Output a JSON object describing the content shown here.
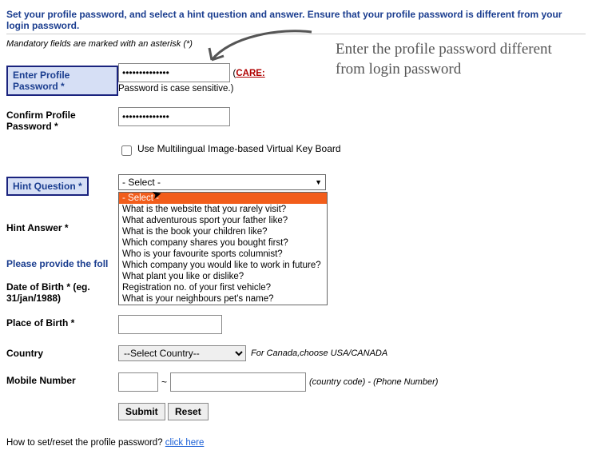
{
  "instruction": "Set your profile password, and select a hint question and answer. Ensure that your profile password is different from your login password.",
  "mandatory_note": "Mandatory fields are marked with an asterisk (*)",
  "labels": {
    "enter_profile_password": "Enter Profile Password *",
    "confirm_profile_password": "Confirm Profile Password *",
    "hint_question": "Hint Question *",
    "hint_answer": "Hint Answer *",
    "date_of_birth": "Date of Birth * (eg. 31/jan/1988)",
    "place_of_birth": "Place of Birth *",
    "country": "Country",
    "mobile_number": "Mobile Number"
  },
  "values": {
    "profile_password": "••••••••••••••",
    "confirm_password": "••••••••••••••",
    "hint_select_display": "- Select -",
    "hint_answer": "",
    "dob": "",
    "pob": "",
    "country": "--Select Country--",
    "country_code": "",
    "phone": ""
  },
  "notes": {
    "password_case": "Password is case sensitive.)",
    "care": "CARE:",
    "care_prefix": "(",
    "virtual_kb": "Use Multilingual Image-based Virtual Key Board",
    "country_hint": "For Canada,choose USA/CANADA",
    "phone_hint": "(country code) - (Phone Number)",
    "tilde": "~"
  },
  "section2_header": "Please provide the foll",
  "hint_options": [
    "- Select -",
    "What is the website that you rarely visit?",
    "What adventurous sport your father like?",
    "What is the book your children like?",
    "Which company shares you bought first?",
    "Who is your favourite sports columnist?",
    "Which company you would like to work in future?",
    "What plant you like or dislike?",
    "Registration no. of your first vehicle?",
    "What is your neighbours pet's name?"
  ],
  "buttons": {
    "submit": "Submit",
    "reset": "Reset"
  },
  "footer": {
    "text": "How to set/reset the profile password? ",
    "link": "click here"
  },
  "annotation": "Enter the profile password different from login password"
}
